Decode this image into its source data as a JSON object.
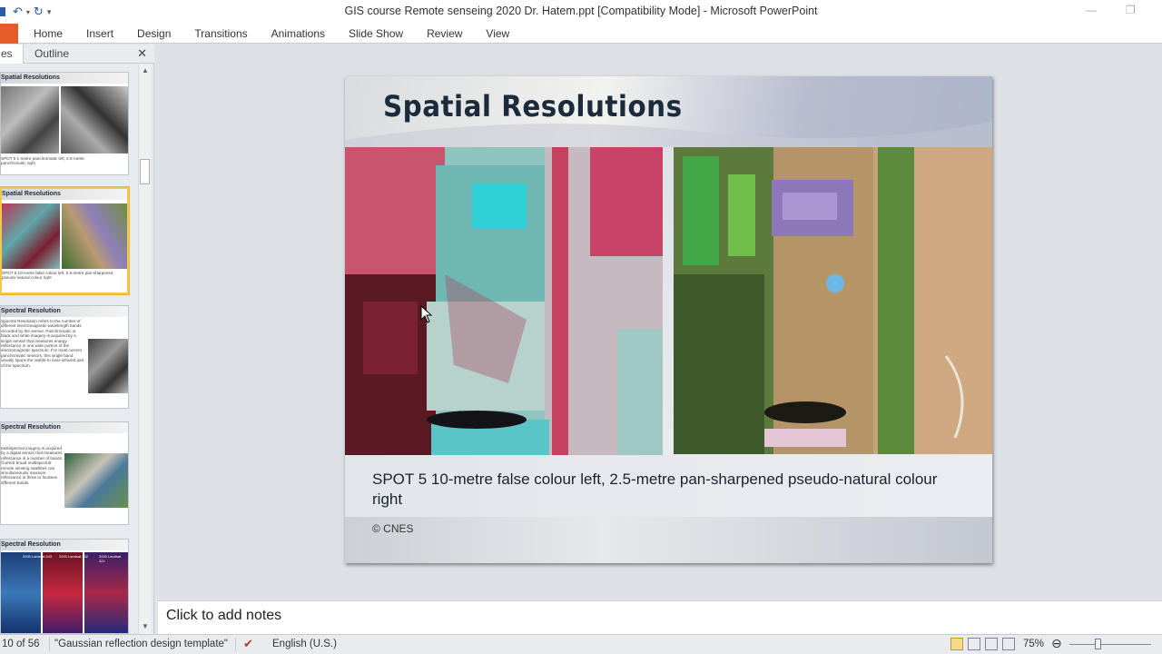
{
  "window": {
    "title": "GIS course Remote senseing 2020 Dr. Hatem.ppt [Compatibility Mode]  -  Microsoft PowerPoint"
  },
  "ribbon": {
    "tabs": [
      "Home",
      "Insert",
      "Design",
      "Transitions",
      "Animations",
      "Slide Show",
      "Review",
      "View"
    ]
  },
  "left_pane": {
    "tab_slides": "es",
    "tab_outline": "Outline",
    "thumbnails": [
      {
        "title": "Spatial Resolutions",
        "caption": "SPOT 5 1-metre panchromatic left, 2.5-metre panchromatic right"
      },
      {
        "title": "Spatial Resolutions",
        "caption": "SPOT 5 10-metre false colour left, 2.5-metre pan-sharpened pseudo-natural colour right"
      },
      {
        "title": "Spectral Resolution",
        "body": "Spectral Resolution refers to the number of different electromagnetic wavelength bands recorded by the sensor. Panchromatic or black and white imagery is acquired by a single sensor that measures energy reflectance in one wide portion of the electromagnetic spectrum. For most current panchromatic sensors, this single band usually spans the visible to near-infrared part of the spectrum."
      },
      {
        "title": "Spectral Resolution",
        "body": "Multispectral imagery is acquired by a digital sensor that measures reflectance in a number of bands. Current broad multispectral remote sensing satellites can simultaneously measure reflectance in three to fourteen different bands."
      },
      {
        "title": "Spectral Resolution",
        "labels": [
          "2000 Landsat 543",
          "2000 Landsat 432",
          "2000 Landsat 321"
        ]
      }
    ]
  },
  "slide": {
    "title": "Spatial Resolutions",
    "caption": "SPOT 5 10-metre false colour left, 2.5-metre pan-sharpened pseudo-natural colour right",
    "credit": "© CNES"
  },
  "notes": {
    "placeholder": "Click to add notes"
  },
  "status": {
    "slide_counter": "10 of 56",
    "theme": "\"Gaussian reflection design template\"",
    "language": "English (U.S.)",
    "zoom": "75%"
  }
}
